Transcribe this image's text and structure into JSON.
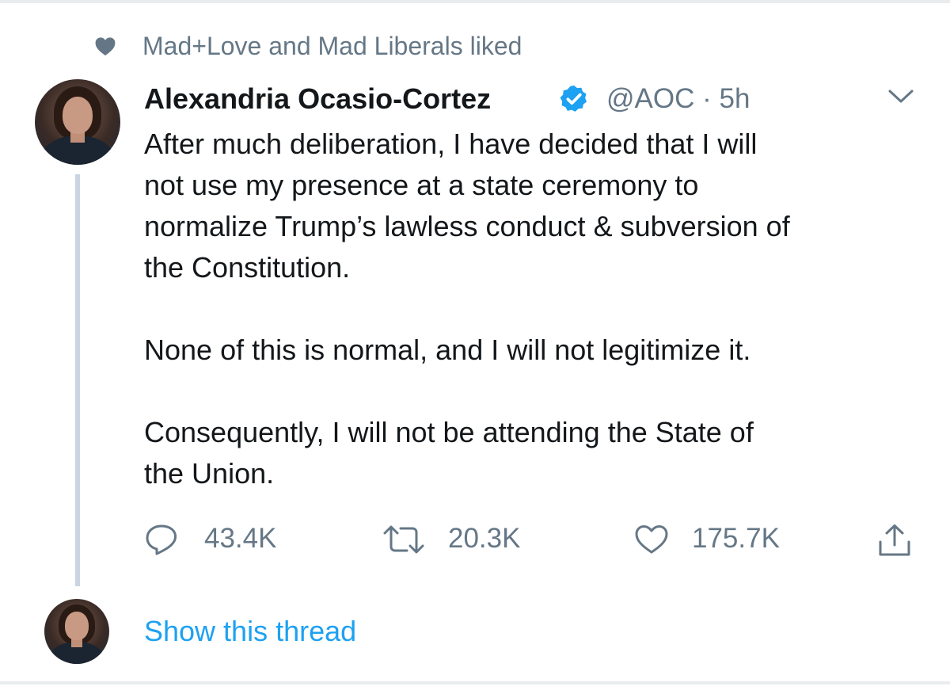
{
  "social_context": {
    "text": "Mad+Love and Mad Liberals liked",
    "icon": "heart-icon"
  },
  "tweet": {
    "author_name": "Alexandria Ocasio-Cortez",
    "verified": true,
    "handle_time": "@AOC · 5h",
    "paragraphs": [
      "After much deliberation, I have decided that I will\nnot use my presence at a state ceremony to\nnormalize Trump’s lawless conduct & subversion of\nthe Constitution.",
      "None of this is normal, and I will not legitimize it.",
      "Consequently, I will not be attending the State of\nthe Union."
    ],
    "actions": {
      "replies": "43.4K",
      "retweets": "20.3K",
      "likes": "175.7K"
    }
  },
  "thread": {
    "show_label": "Show this thread"
  },
  "colors": {
    "text": "#14171a",
    "muted": "#657786",
    "link": "#1da1f2",
    "verified": "#1da1f2",
    "thread_line": "#c9d5e0"
  }
}
